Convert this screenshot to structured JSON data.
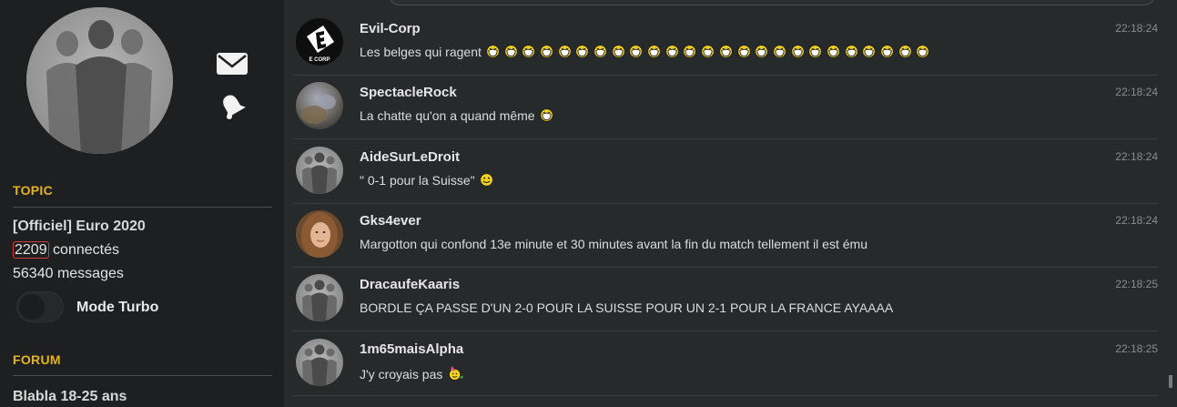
{
  "sidebar": {
    "topic_heading": "TOPIC",
    "topic_title": "[Officiel] Euro 2020",
    "connected_count": "2209",
    "connected_label": " connectés",
    "messages_line": "56340 messages",
    "turbo_label": "Mode Turbo",
    "forum_heading": "FORUM",
    "forum_name": "Blabla 18-25 ans",
    "icons": [
      "mail-icon",
      "bell-icon"
    ],
    "accent_color": "#e6b31e"
  },
  "messages": [
    {
      "user": "Evil-Corp",
      "time": "22:18:24",
      "text": "Les belges qui ragent",
      "smileys": 25,
      "smiley_type": "laugh",
      "avatar": "evil-corp-logo",
      "avatar_text": "E CORP"
    },
    {
      "user": "SpectacleRock",
      "time": "22:18:24",
      "text": "La chatte qu'on a quand même",
      "smileys": 1,
      "smiley_type": "laugh",
      "avatar": "photo"
    },
    {
      "user": "AideSurLeDroit",
      "time": "22:18:24",
      "text": "\" 0-1 pour la Suisse\"",
      "smileys": 1,
      "smiley_type": "smile",
      "avatar": "default"
    },
    {
      "user": "Gks4ever",
      "time": "22:18:24",
      "text": "Margotton qui confond 13e minute et 30 minutes avant la fin du match tellement il est ému",
      "smileys": 0,
      "avatar": "photo-woman"
    },
    {
      "user": "DracaufeKaaris",
      "time": "22:18:25",
      "text": "BORDLE ÇA PASSE D'UN 2-0 POUR LA SUISSE POUR UN 2-1 POUR LA FRANCE AYAAAA",
      "smileys": 0,
      "avatar": "default"
    },
    {
      "user": "1m65maisAlpha",
      "time": "22:18:25",
      "text": "J'y croyais pas",
      "smileys": 1,
      "smiley_type": "party",
      "avatar": "default"
    }
  ]
}
